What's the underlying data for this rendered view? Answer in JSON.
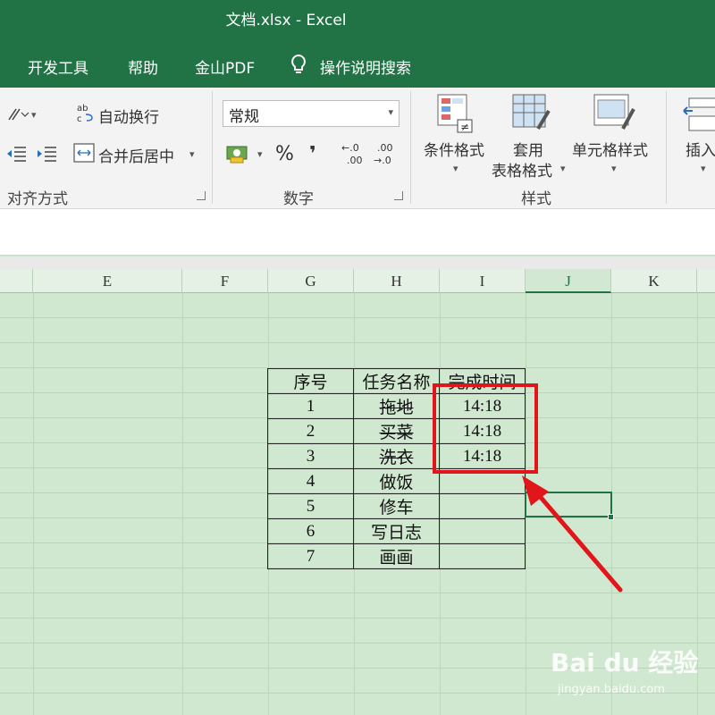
{
  "window": {
    "title": "文档.xlsx  -  Excel"
  },
  "tabs": [
    "开发工具",
    "帮助",
    "金山PDF",
    "操作说明搜索"
  ],
  "ribbon": {
    "alignment": {
      "wrap_text": "自动换行",
      "merge_center": "合并后居中",
      "group_label": "对齐方式"
    },
    "number": {
      "format_value": "常规",
      "percent": "%",
      "comma": "❜",
      "group_label": "数字"
    },
    "styles": {
      "conditional": "条件格式",
      "table_format_1": "套用",
      "table_format_2": "表格格式",
      "cell_styles": "单元格样式",
      "group_label": "样式"
    },
    "cells": {
      "insert": "插入"
    }
  },
  "columns": [
    "E",
    "F",
    "G",
    "H",
    "I",
    "J",
    "K"
  ],
  "selected_column": "J",
  "table": {
    "headers": [
      "序号",
      "任务名称",
      "完成时间"
    ],
    "rows": [
      {
        "no": "1",
        "task": "拖地",
        "time": "14:18",
        "done": true
      },
      {
        "no": "2",
        "task": "买菜",
        "time": "14:18",
        "done": true
      },
      {
        "no": "3",
        "task": "洗衣",
        "time": "14:18",
        "done": true
      },
      {
        "no": "4",
        "task": "做饭",
        "time": "",
        "done": false
      },
      {
        "no": "5",
        "task": "修车",
        "time": "",
        "done": false
      },
      {
        "no": "6",
        "task": "写日志",
        "time": "",
        "done": false
      },
      {
        "no": "7",
        "task": "画画",
        "time": "",
        "done": false
      }
    ]
  },
  "watermark": {
    "brand": "Bai du 经验",
    "url": "jingyan.baidu.com"
  },
  "colors": {
    "excel_green": "#217346",
    "highlight_red": "#e0161b",
    "sheet_bg": "#cfe8cf"
  }
}
